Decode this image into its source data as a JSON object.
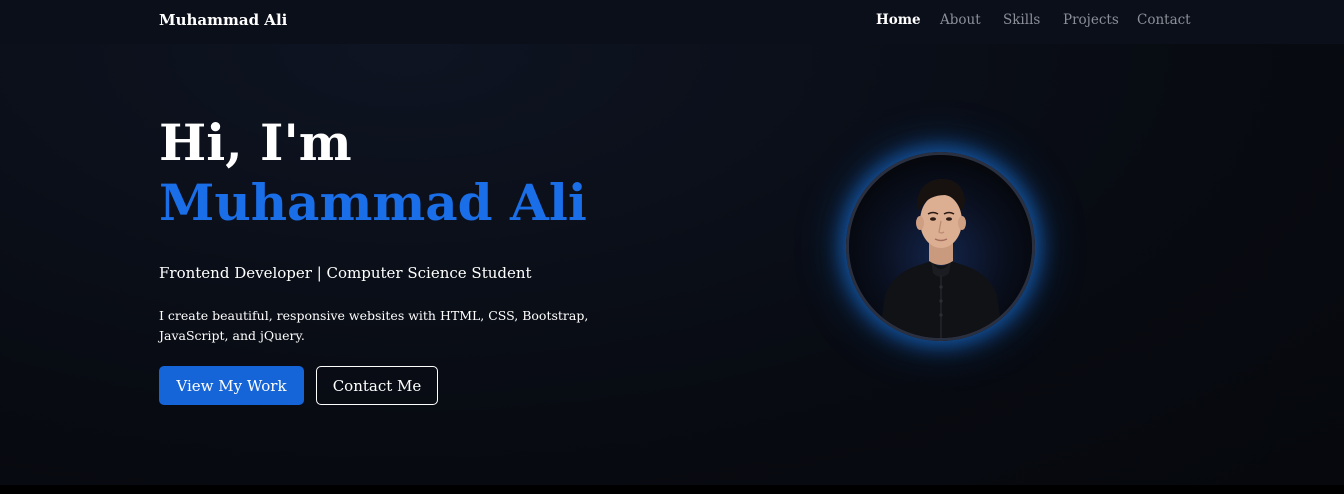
{
  "navbar": {
    "brand": "Muhammad Ali",
    "links": [
      {
        "label": "Home",
        "active": true
      },
      {
        "label": "About",
        "active": false
      },
      {
        "label": "Skills",
        "active": false
      },
      {
        "label": "Projects",
        "active": false
      },
      {
        "label": "Contact",
        "active": false
      }
    ]
  },
  "hero": {
    "greeting": "Hi, I'm",
    "name": "Muhammad Ali",
    "subtitle": "Frontend Developer | Computer Science Student",
    "description": "I create beautiful, responsive websites with HTML, CSS, Bootstrap, JavaScript, and jQuery.",
    "primary_button": "View My Work",
    "secondary_button": "Contact Me"
  },
  "colors": {
    "accent": "#1a6ee8",
    "primary_button_bg": "#1565d8",
    "background": "#080b12",
    "glow": "#1978e6"
  }
}
